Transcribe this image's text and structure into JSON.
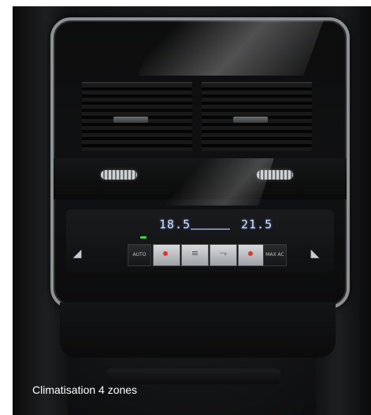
{
  "caption": "Climatisation 4 zones",
  "climate_panel": {
    "temp_left": "18.5",
    "temp_right": "21.5",
    "auto_label": "AUTO",
    "max_ac_label": "MAX AC",
    "buttons": [
      {
        "icon": "heat-left-icon",
        "dot_color": "#e0362b"
      },
      {
        "icon": "fan-icon",
        "dot_color": null
      },
      {
        "icon": "airflow-icon",
        "dot_color": null
      },
      {
        "icon": "heat-right-icon",
        "dot_color": "#e0362b"
      }
    ],
    "led_color": "#3fd24b"
  }
}
